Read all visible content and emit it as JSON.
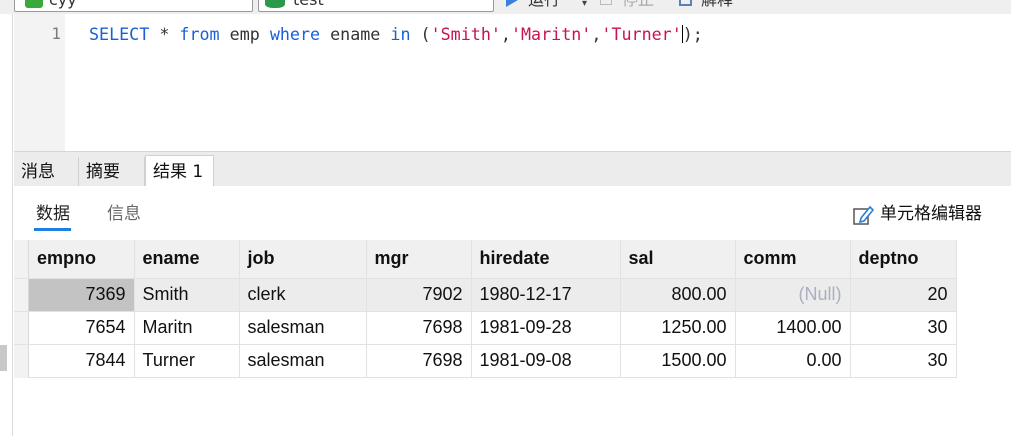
{
  "toolbar": {
    "connection": "cyy",
    "database": "test",
    "run_label": "运行",
    "run_caret": "▾",
    "stop_label": "停止",
    "explain_label": "解释"
  },
  "editor": {
    "line_number": "1",
    "sql_tokens": [
      {
        "t": "SELECT",
        "k": "kw"
      },
      {
        "t": " * ",
        "k": "plain"
      },
      {
        "t": "from",
        "k": "kw"
      },
      {
        "t": " emp ",
        "k": "plain"
      },
      {
        "t": "where",
        "k": "kw"
      },
      {
        "t": " ename ",
        "k": "plain"
      },
      {
        "t": "in",
        "k": "kw"
      },
      {
        "t": " (",
        "k": "plain"
      },
      {
        "t": "'Smith'",
        "k": "str"
      },
      {
        "t": ",",
        "k": "plain"
      },
      {
        "t": "'Maritn'",
        "k": "str"
      },
      {
        "t": ",",
        "k": "plain"
      },
      {
        "t": "'Turner'",
        "k": "str"
      },
      {
        "t": "|",
        "k": "caret"
      },
      {
        "t": ");",
        "k": "plain"
      }
    ]
  },
  "tabs": {
    "messages": "消息",
    "summary": "摘要",
    "result": "结果 1"
  },
  "subtabs": {
    "data": "数据",
    "info": "信息",
    "cell_editor": "单元格编辑器"
  },
  "table": {
    "columns": [
      {
        "key": "empno",
        "label": "empno",
        "width": 105,
        "align": "right"
      },
      {
        "key": "ename",
        "label": "ename",
        "width": 105,
        "align": "left"
      },
      {
        "key": "job",
        "label": "job",
        "width": 127,
        "align": "left"
      },
      {
        "key": "mgr",
        "label": "mgr",
        "width": 105,
        "align": "right"
      },
      {
        "key": "hiredate",
        "label": "hiredate",
        "width": 149,
        "align": "left"
      },
      {
        "key": "sal",
        "label": "sal",
        "width": 115,
        "align": "right"
      },
      {
        "key": "comm",
        "label": "comm",
        "width": 115,
        "align": "right"
      },
      {
        "key": "deptno",
        "label": "deptno",
        "width": 106,
        "align": "right"
      }
    ],
    "rows": [
      {
        "empno": "7369",
        "ename": "Smith",
        "job": "clerk",
        "mgr": "7902",
        "hiredate": "1980-12-17",
        "sal": "800.00",
        "comm": "(Null)",
        "deptno": "20"
      },
      {
        "empno": "7654",
        "ename": "Maritn",
        "job": "salesman",
        "mgr": "7698",
        "hiredate": "1981-09-28",
        "sal": "1250.00",
        "comm": "1400.00",
        "deptno": "30"
      },
      {
        "empno": "7844",
        "ename": "Turner",
        "job": "salesman",
        "mgr": "7698",
        "hiredate": "1981-09-08",
        "sal": "1500.00",
        "comm": "0.00",
        "deptno": "30"
      }
    ],
    "selected_row": 0,
    "focused_column": "empno",
    "null_marker": "(Null)"
  }
}
